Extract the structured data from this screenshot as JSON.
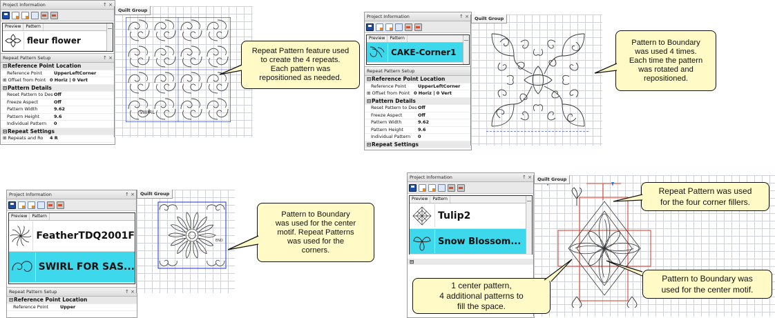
{
  "common": {
    "project_info_title": "Project Information",
    "repeat_setup_title": "Repeat Pattern Setup",
    "quilt_tab": "Quilt Group",
    "col_preview": "Preview",
    "col_pattern": "Pattern",
    "pin_close": "↑ ×"
  },
  "panel1": {
    "patterns": [
      "fleur flower"
    ],
    "groups": [
      {
        "title": "Reference Point Location",
        "rows": [
          {
            "k": "Reference Point",
            "v": "UpperLeftCorner"
          },
          {
            "k": "Offset from Point",
            "v": "0 Horiz | 0 Vert",
            "plus": true
          }
        ]
      },
      {
        "title": "Pattern Details",
        "rows": [
          {
            "k": "Reset Pattern to Des",
            "v": "Off"
          },
          {
            "k": "Freeze Aspect",
            "v": "Off"
          },
          {
            "k": "Pattern Width",
            "v": "9.62"
          },
          {
            "k": "Pattern Height",
            "v": "9.6"
          },
          {
            "k": "Individual Pattern",
            "v": "0"
          }
        ]
      },
      {
        "title": "Repeat Settings",
        "rows": [
          {
            "k": "Repeats and Ro",
            "v": "4 R",
            "plus": true
          }
        ]
      }
    ],
    "canvas_label": "SWIRL",
    "callout": [
      "Repeat Pattern feature used",
      "to create the 4 repeats.",
      "Each pattern was",
      "repositioned as needed."
    ]
  },
  "panel2": {
    "patterns": [
      "CAKE-Corner1"
    ],
    "groups": [
      {
        "title": "Reference Point Location",
        "rows": [
          {
            "k": "Reference Point",
            "v": "UpperLeftCorner"
          },
          {
            "k": "Offset from Point",
            "v": "0 Horiz | 0 Vert",
            "plus": true
          }
        ]
      },
      {
        "title": "Pattern Details",
        "rows": [
          {
            "k": "Reset Pattern to Des",
            "v": "Off"
          },
          {
            "k": "Freeze Aspect",
            "v": "Off"
          },
          {
            "k": "Pattern Width",
            "v": "9.62"
          },
          {
            "k": "Pattern Height",
            "v": "9.6"
          },
          {
            "k": "Individual Pattern",
            "v": "0"
          }
        ]
      },
      {
        "title": "Repeat Settings",
        "rows": []
      }
    ],
    "callout": [
      "Pattern to Boundary",
      "was used 4 times.",
      "Each time the pattern",
      "was rotated and",
      "repositioned."
    ]
  },
  "panel3": {
    "patterns": [
      "FeatherTDQ2001F",
      "SWIRL FOR SAS..."
    ],
    "groups": [
      {
        "title": "Reference Point Location",
        "rows": [
          {
            "k": "Reference Point",
            "v": "Upper"
          }
        ]
      }
    ],
    "canvas_label": "END",
    "callout": [
      "Pattern to Boundary",
      "was used for the center",
      "motif. Repeat Patterns",
      "was used for the",
      "corners."
    ]
  },
  "panel4": {
    "patterns": [
      "Tulip2",
      "Snow Blossom..."
    ],
    "callout_top": [
      "Repeat Pattern was used",
      "for the four corner fillers."
    ],
    "callout_left": [
      "1 center pattern,",
      "4 additional patterns to",
      "fill the space."
    ],
    "callout_right": [
      "Pattern to Boundary was",
      "used for the center motif."
    ]
  },
  "colors": {
    "selection": "#3dd8ec",
    "callout_fill": "#fffac6",
    "boundary_blue": "#2a3fd6",
    "boundary_red": "#e0453a"
  }
}
